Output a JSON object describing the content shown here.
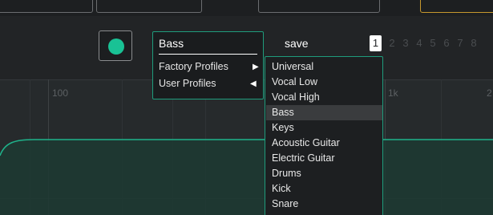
{
  "status": {
    "indicator_color": "#19c295"
  },
  "profile_panel": {
    "current_profile": "Bass",
    "menu": [
      {
        "label": "Factory Profiles",
        "arrow": "▶"
      },
      {
        "label": "User Profiles",
        "arrow": "◀"
      }
    ]
  },
  "save_label": "save",
  "slots": {
    "active": "1",
    "others": [
      "2",
      "3",
      "4",
      "5",
      "6",
      "7",
      "8"
    ]
  },
  "dropdown": {
    "items": [
      "Universal",
      "Vocal Low",
      "Vocal High",
      "Bass",
      "Keys",
      "Acoustic Guitar",
      "Electric Guitar",
      "Drums",
      "Kick",
      "Snare"
    ],
    "selected": "Bass"
  },
  "graph": {
    "axis_labels": {
      "hz_100": "100",
      "hz_1k": "1k",
      "right_edge": "2"
    },
    "accent_color": "#1f9c7c"
  }
}
